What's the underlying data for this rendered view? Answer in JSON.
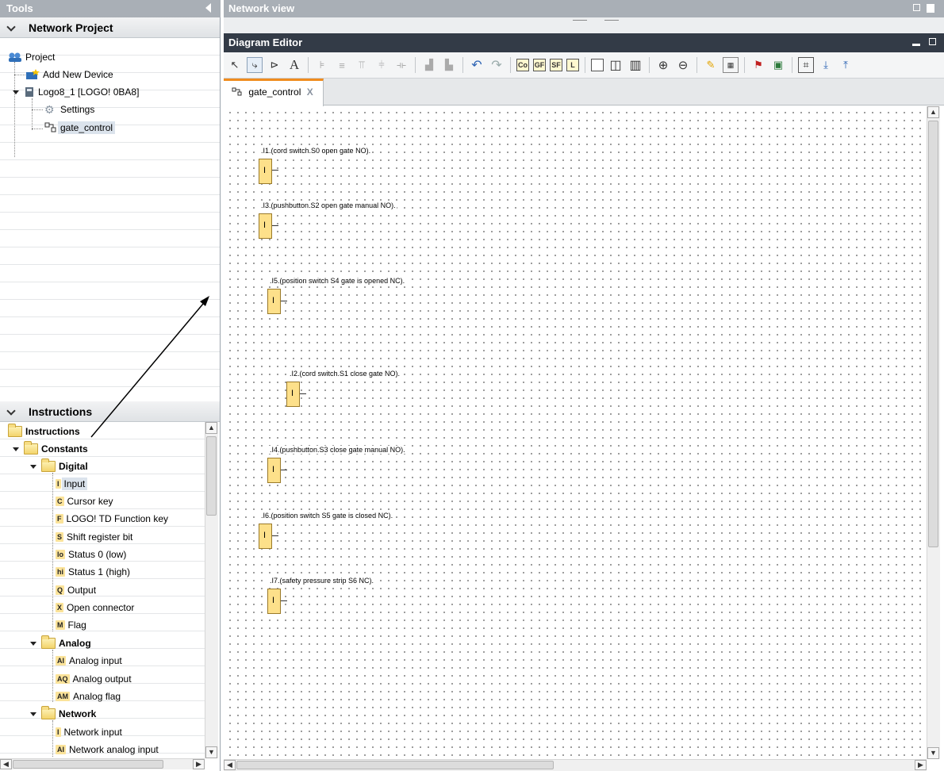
{
  "tools_panel": {
    "title": "Tools"
  },
  "network_project": {
    "header": "Network Project",
    "items": [
      "Project",
      "Add New Device",
      "Logo8_1 [LOGO! 0BA8]",
      "Settings",
      "gate_control"
    ]
  },
  "instructions": {
    "header": "Instructions",
    "root": "Instructions",
    "constants": "Constants",
    "digital": "Digital",
    "digital_items": [
      {
        "badge": "I",
        "label": "Input"
      },
      {
        "badge": "C",
        "label": "Cursor key"
      },
      {
        "badge": "F",
        "label": "LOGO! TD Function key"
      },
      {
        "badge": "S",
        "label": "Shift register bit"
      },
      {
        "badge": "lo",
        "label": "Status 0 (low)"
      },
      {
        "badge": "hi",
        "label": "Status 1 (high)"
      },
      {
        "badge": "Q",
        "label": "Output"
      },
      {
        "badge": "X",
        "label": "Open connector"
      },
      {
        "badge": "M",
        "label": "Flag"
      }
    ],
    "analog": "Analog",
    "analog_items": [
      {
        "badge": "AI",
        "label": "Analog input"
      },
      {
        "badge": "AQ",
        "label": "Analog output"
      },
      {
        "badge": "AM",
        "label": "Analog flag"
      }
    ],
    "network": "Network",
    "network_items": [
      {
        "badge": "I",
        "label": "Network input"
      },
      {
        "badge": "AI",
        "label": "Network analog input"
      }
    ]
  },
  "network_view": {
    "title": "Network view"
  },
  "diagram_editor": {
    "title": "Diagram Editor",
    "tab": "gate_control",
    "tab_close": "X"
  },
  "toolbar": {
    "text_tool": "A",
    "co": "Co",
    "gf": "GF",
    "sf": "SF",
    "l": "L"
  },
  "blocks": [
    {
      "letter": "I",
      "label": ".I1.(cord switch.S0 open gate NO)."
    },
    {
      "letter": "I",
      "label": ".I3.(pushbutton.S2 open gate manual NO)."
    },
    {
      "letter": "I",
      "label": ".I5.(position switch S4 gate is opened NC)."
    },
    {
      "letter": "I",
      "label": ".I2.(cord switch.S1 close gate NO)."
    },
    {
      "letter": "I",
      "label": ".I4.(pushbutton.S3 close gate manual NO)."
    },
    {
      "letter": "I",
      "label": ".I6.(position switch S5 gate is closed NC)."
    },
    {
      "letter": "I",
      "label": ".I7.(safety pressure strip S6 NC)."
    }
  ],
  "colors": {
    "accent_tab": "#f08c1e",
    "block_fill": "#fde08a",
    "header_dark": "#333b47",
    "panel_bar": "#a9afb6"
  }
}
